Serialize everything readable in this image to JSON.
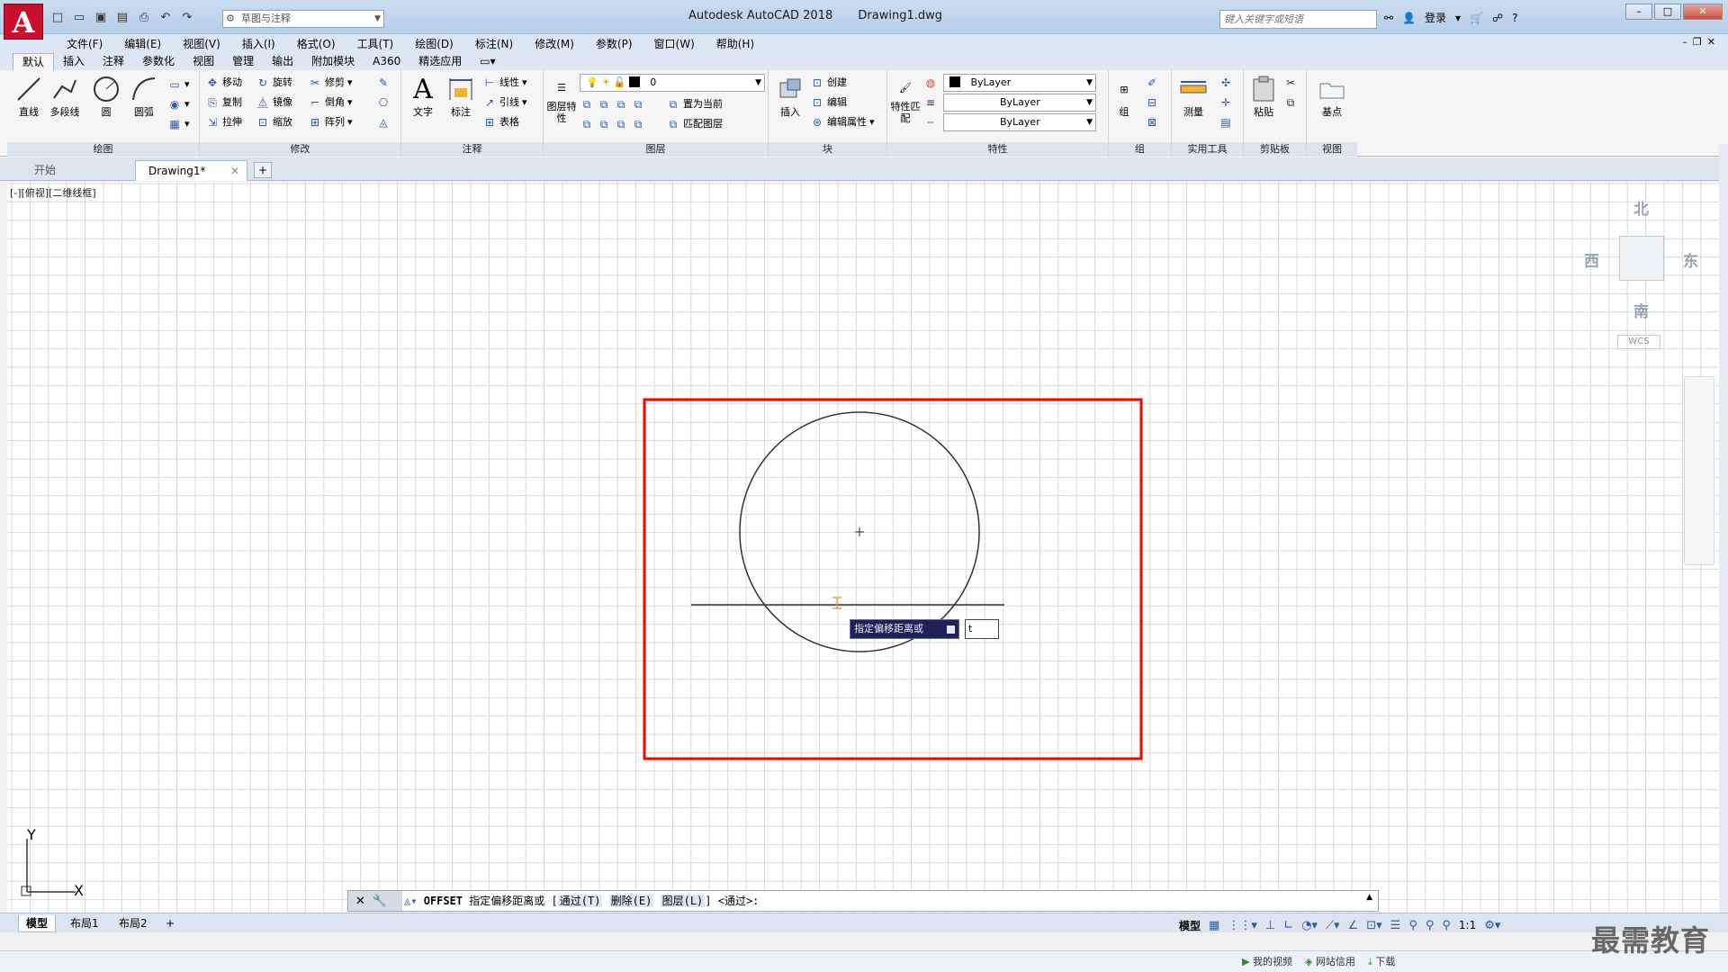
{
  "app": {
    "logo": "A",
    "title": "Autodesk AutoCAD 2018",
    "file": "Drawing1.dwg",
    "workspace": "草图与注释",
    "search_placeholder": "键入关键字或短语",
    "login": "登录"
  },
  "menu": [
    "文件(F)",
    "编辑(E)",
    "视图(V)",
    "插入(I)",
    "格式(O)",
    "工具(T)",
    "绘图(D)",
    "标注(N)",
    "修改(M)",
    "参数(P)",
    "窗口(W)",
    "帮助(H)"
  ],
  "ribbon_tabs": [
    "默认",
    "插入",
    "注释",
    "参数化",
    "视图",
    "管理",
    "输出",
    "附加模块",
    "A360",
    "精选应用"
  ],
  "panels": {
    "draw": {
      "title": "绘图",
      "line": "直线",
      "polyline": "多段线",
      "circle": "圆",
      "arc": "圆弧"
    },
    "modify": {
      "title": "修改",
      "move": "移动",
      "rotate": "旋转",
      "trim": "修剪",
      "copy": "复制",
      "mirror": "镜像",
      "fillet": "倒角",
      "stretch": "拉伸",
      "scale": "缩放",
      "array": "阵列"
    },
    "annotate": {
      "title": "注释",
      "text": "文字",
      "dim": "标注",
      "linear": "线性",
      "leader": "引线",
      "table": "表格"
    },
    "layers": {
      "title": "图层",
      "props": "图层特性",
      "current_layer": "0",
      "set_current": "置为当前",
      "match_layer": "匹配图层"
    },
    "block": {
      "title": "块",
      "insert": "插入",
      "create": "创建",
      "edit": "编辑",
      "edit_attr": "编辑属性"
    },
    "properties": {
      "title": "特性",
      "match": "特性匹配",
      "color": "ByLayer",
      "linetype": "ByLayer",
      "lineweight": "ByLayer"
    },
    "groups": {
      "title": "组",
      "group": "组"
    },
    "utilities": {
      "title": "实用工具",
      "measure": "测量"
    },
    "clipboard": {
      "title": "剪贴板",
      "paste": "粘贴"
    },
    "view": {
      "title": "视图",
      "base": "基点"
    }
  },
  "file_tabs": {
    "start": "开始",
    "doc": "Drawing1*"
  },
  "viewport_label": "[-][俯视][二维线框]",
  "viewcube": {
    "north": "北",
    "south": "南",
    "east": "东",
    "west": "西",
    "wcs": "WCS"
  },
  "ucs": {
    "x": "X",
    "y": "Y"
  },
  "dynamic_input": {
    "prompt": "指定偏移距离或",
    "value": "t"
  },
  "command": {
    "name": "OFFSET",
    "prompt": "指定偏移距离或",
    "opt1": "通过(T)",
    "opt2": "删除(E)",
    "opt3": "图层(L)",
    "default": "<通过>:"
  },
  "layout_tabs": [
    "模型",
    "布局1",
    "布局2"
  ],
  "status": {
    "model": "模型",
    "scale": "1:1"
  },
  "sysbar": [
    "我的视频",
    "网站信用",
    "下载"
  ],
  "watermark": "最需教育",
  "colors": {
    "highlight": "#ff0000",
    "tooltip": "#20205a",
    "grid": "#d9d9d9"
  }
}
